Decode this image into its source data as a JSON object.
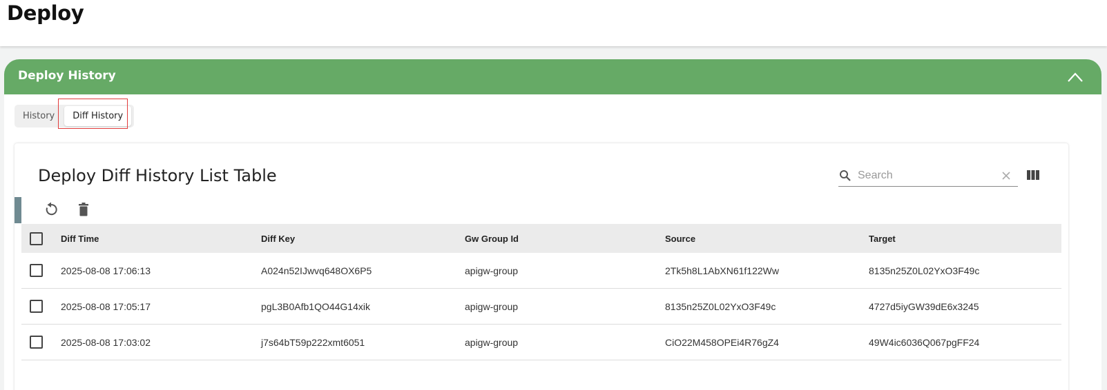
{
  "page": {
    "title": "Deploy"
  },
  "card": {
    "title": "Deploy History",
    "header_color": "#66aa66",
    "collapse_icon": "chevron-up-icon"
  },
  "tabs": [
    {
      "label": "History",
      "active": false
    },
    {
      "label": "Diff History",
      "active": true
    }
  ],
  "table": {
    "title": "Deploy Diff History List Table",
    "search": {
      "placeholder": "Search",
      "value": ""
    },
    "toolbar": {
      "refresh_icon": "refresh-icon",
      "delete_icon": "trash-icon",
      "columns_icon": "view-columns-icon"
    },
    "columns": [
      "Diff Time",
      "Diff Key",
      "Gw Group Id",
      "Source",
      "Target"
    ],
    "rows": [
      {
        "diff_time": "2025-08-08 17:06:13",
        "diff_key": "A024n52IJwvq648OX6P5",
        "gw_group_id": "apigw-group",
        "source": "2Tk5h8L1AbXN61f122Ww",
        "target": "8135n25Z0L02YxO3F49c"
      },
      {
        "diff_time": "2025-08-08 17:05:17",
        "diff_key": "pgL3B0Afb1QO44G14xik",
        "gw_group_id": "apigw-group",
        "source": "8135n25Z0L02YxO3F49c",
        "target": "4727d5iyGW39dE6x3245"
      },
      {
        "diff_time": "2025-08-08 17:03:02",
        "diff_key": "j7s64bT59p222xmt6051",
        "gw_group_id": "apigw-group",
        "source": "CiO22M458OPEi4R76gZ4",
        "target": "49W4ic6036Q067pgFF24"
      }
    ]
  }
}
